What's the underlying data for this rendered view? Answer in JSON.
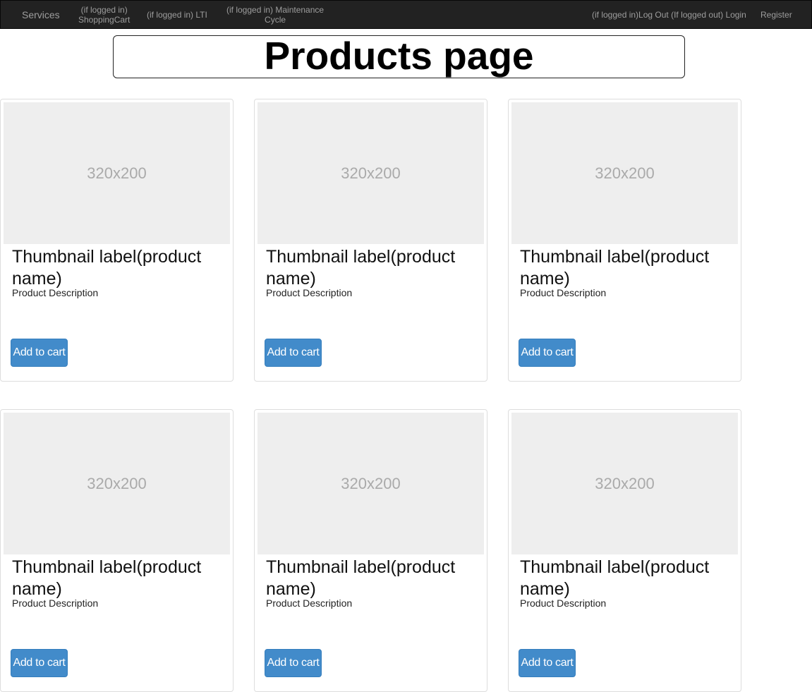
{
  "navbar": {
    "brand": "Services",
    "links": [
      {
        "line1": "(if logged in)",
        "line2": "ShoppingCart"
      },
      {
        "line1": "(if logged in) LTI",
        "line2": ""
      },
      {
        "line1": "(if logged in) Maintenance",
        "line2": "Cycle"
      }
    ],
    "logout_login": "(if logged in)Log Out (If logged out) Login",
    "register": "Register"
  },
  "page": {
    "title": "Products page"
  },
  "products": [
    {
      "image_text": "320x200",
      "label": "Thumbnail label(product name)",
      "description": "Product Description",
      "button": "Add to cart"
    },
    {
      "image_text": "320x200",
      "label": "Thumbnail label(product name)",
      "description": "Product Description",
      "button": "Add to cart"
    },
    {
      "image_text": "320x200",
      "label": "Thumbnail label(product name)",
      "description": "Product Description",
      "button": "Add to cart"
    },
    {
      "image_text": "320x200",
      "label": "Thumbnail label(product name)",
      "description": "Product Description",
      "button": "Add to cart"
    },
    {
      "image_text": "320x200",
      "label": "Thumbnail label(product name)",
      "description": "Product Description",
      "button": "Add to cart"
    },
    {
      "image_text": "320x200",
      "label": "Thumbnail label(product name)",
      "description": "Product Description",
      "button": "Add to cart"
    }
  ],
  "colors": {
    "navbar_bg": "#222222",
    "nav_text": "#9d9d9d",
    "button_bg": "#428bca",
    "placeholder_bg": "#eeeeee"
  }
}
